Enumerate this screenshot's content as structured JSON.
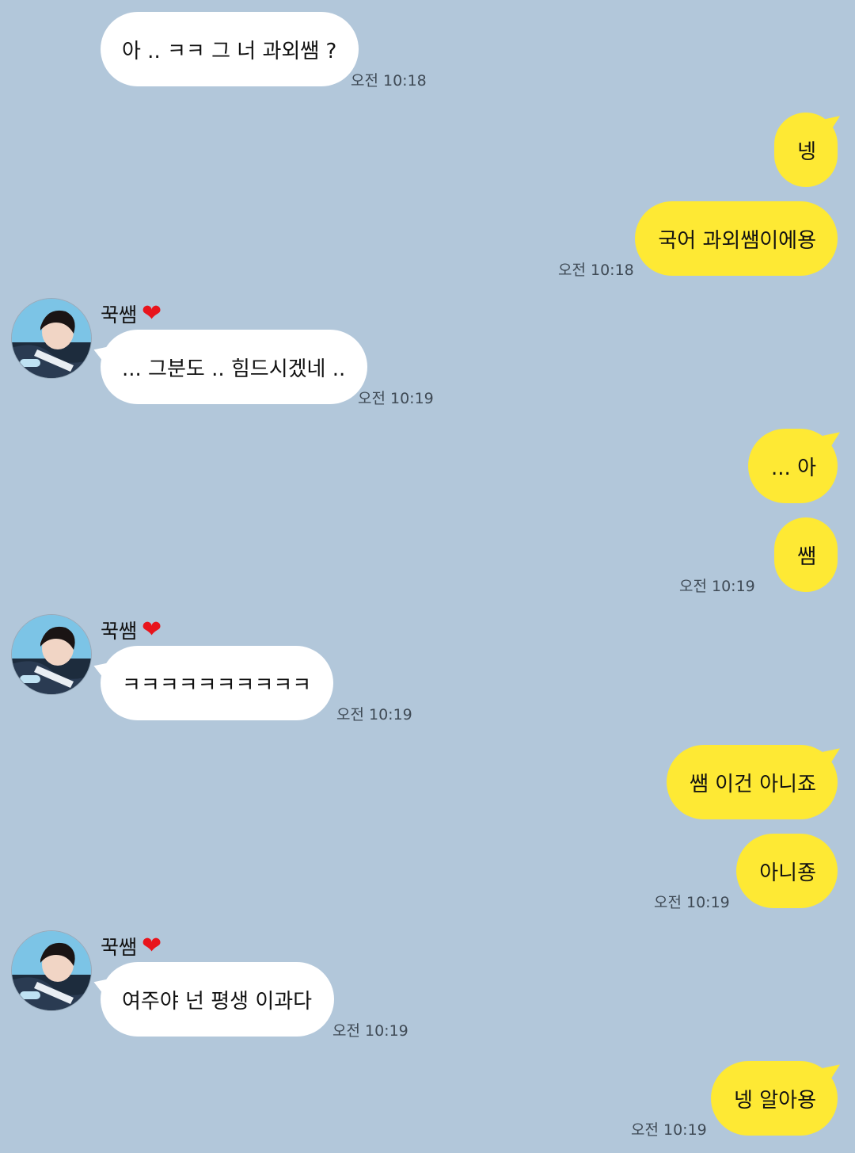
{
  "contact": {
    "name": "꾹쌤",
    "heart": "❤"
  },
  "colors": {
    "background": "#b2c7da",
    "incoming": "#ffffff",
    "outgoing": "#fee934"
  },
  "messages": [
    {
      "dir": "in",
      "text": "아 .. ㅋㅋ 그 너 과외쌤 ?",
      "time": "오전 10:18"
    },
    {
      "dir": "out",
      "text": "넹"
    },
    {
      "dir": "out",
      "text": "국어 과외쌤이에용",
      "time": "오전 10:18"
    },
    {
      "dir": "in",
      "text": "... 그분도 .. 힘드시겠네 ..",
      "time": "오전 10:19"
    },
    {
      "dir": "out",
      "text": "... 아"
    },
    {
      "dir": "out",
      "text": "쌤",
      "time": "오전 10:19"
    },
    {
      "dir": "in",
      "text": "ㅋㅋㅋㅋㅋㅋㅋㅋㅋㅋ",
      "time": "오전 10:19"
    },
    {
      "dir": "out",
      "text": "쌤 이건 아니죠"
    },
    {
      "dir": "out",
      "text": "아니죵",
      "time": "오전 10:19"
    },
    {
      "dir": "in",
      "text": "여주야 넌 평생 이과다",
      "time": "오전 10:19"
    },
    {
      "dir": "out",
      "text": "넹 알아용",
      "time": "오전 10:19"
    }
  ]
}
